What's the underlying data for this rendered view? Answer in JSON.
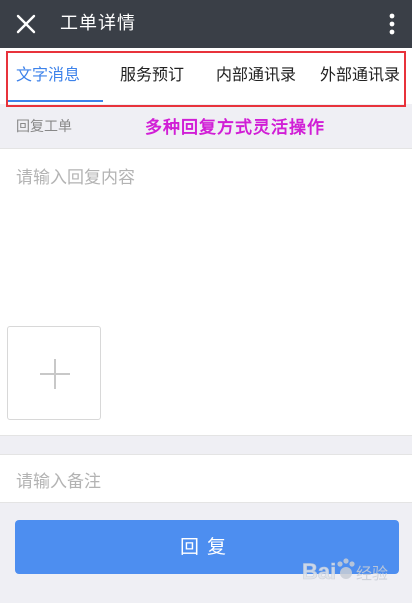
{
  "header": {
    "title": "工单详情",
    "close_icon": "close-icon",
    "more_icon": "more-vertical-icon",
    "background": "#3a3f47"
  },
  "tabs": [
    {
      "label": "文字消息",
      "active": true
    },
    {
      "label": "服务预订",
      "active": false
    },
    {
      "label": "内部通讯录",
      "active": false
    },
    {
      "label": "外部通讯录",
      "active": false
    }
  ],
  "annotation": {
    "text": "多种回复方式灵活操作",
    "color": "#d11ed6"
  },
  "reply": {
    "section_label": "回复工单",
    "content_placeholder": "请输入回复内容",
    "add_icon": "plus-icon",
    "note_placeholder": "请输入备注",
    "submit_label": "回复"
  },
  "colors": {
    "accent": "#3d82ea",
    "button": "#4d8ef0",
    "highlight_border": "#e8323b"
  },
  "watermark": {
    "text": "Baidu 经验"
  }
}
